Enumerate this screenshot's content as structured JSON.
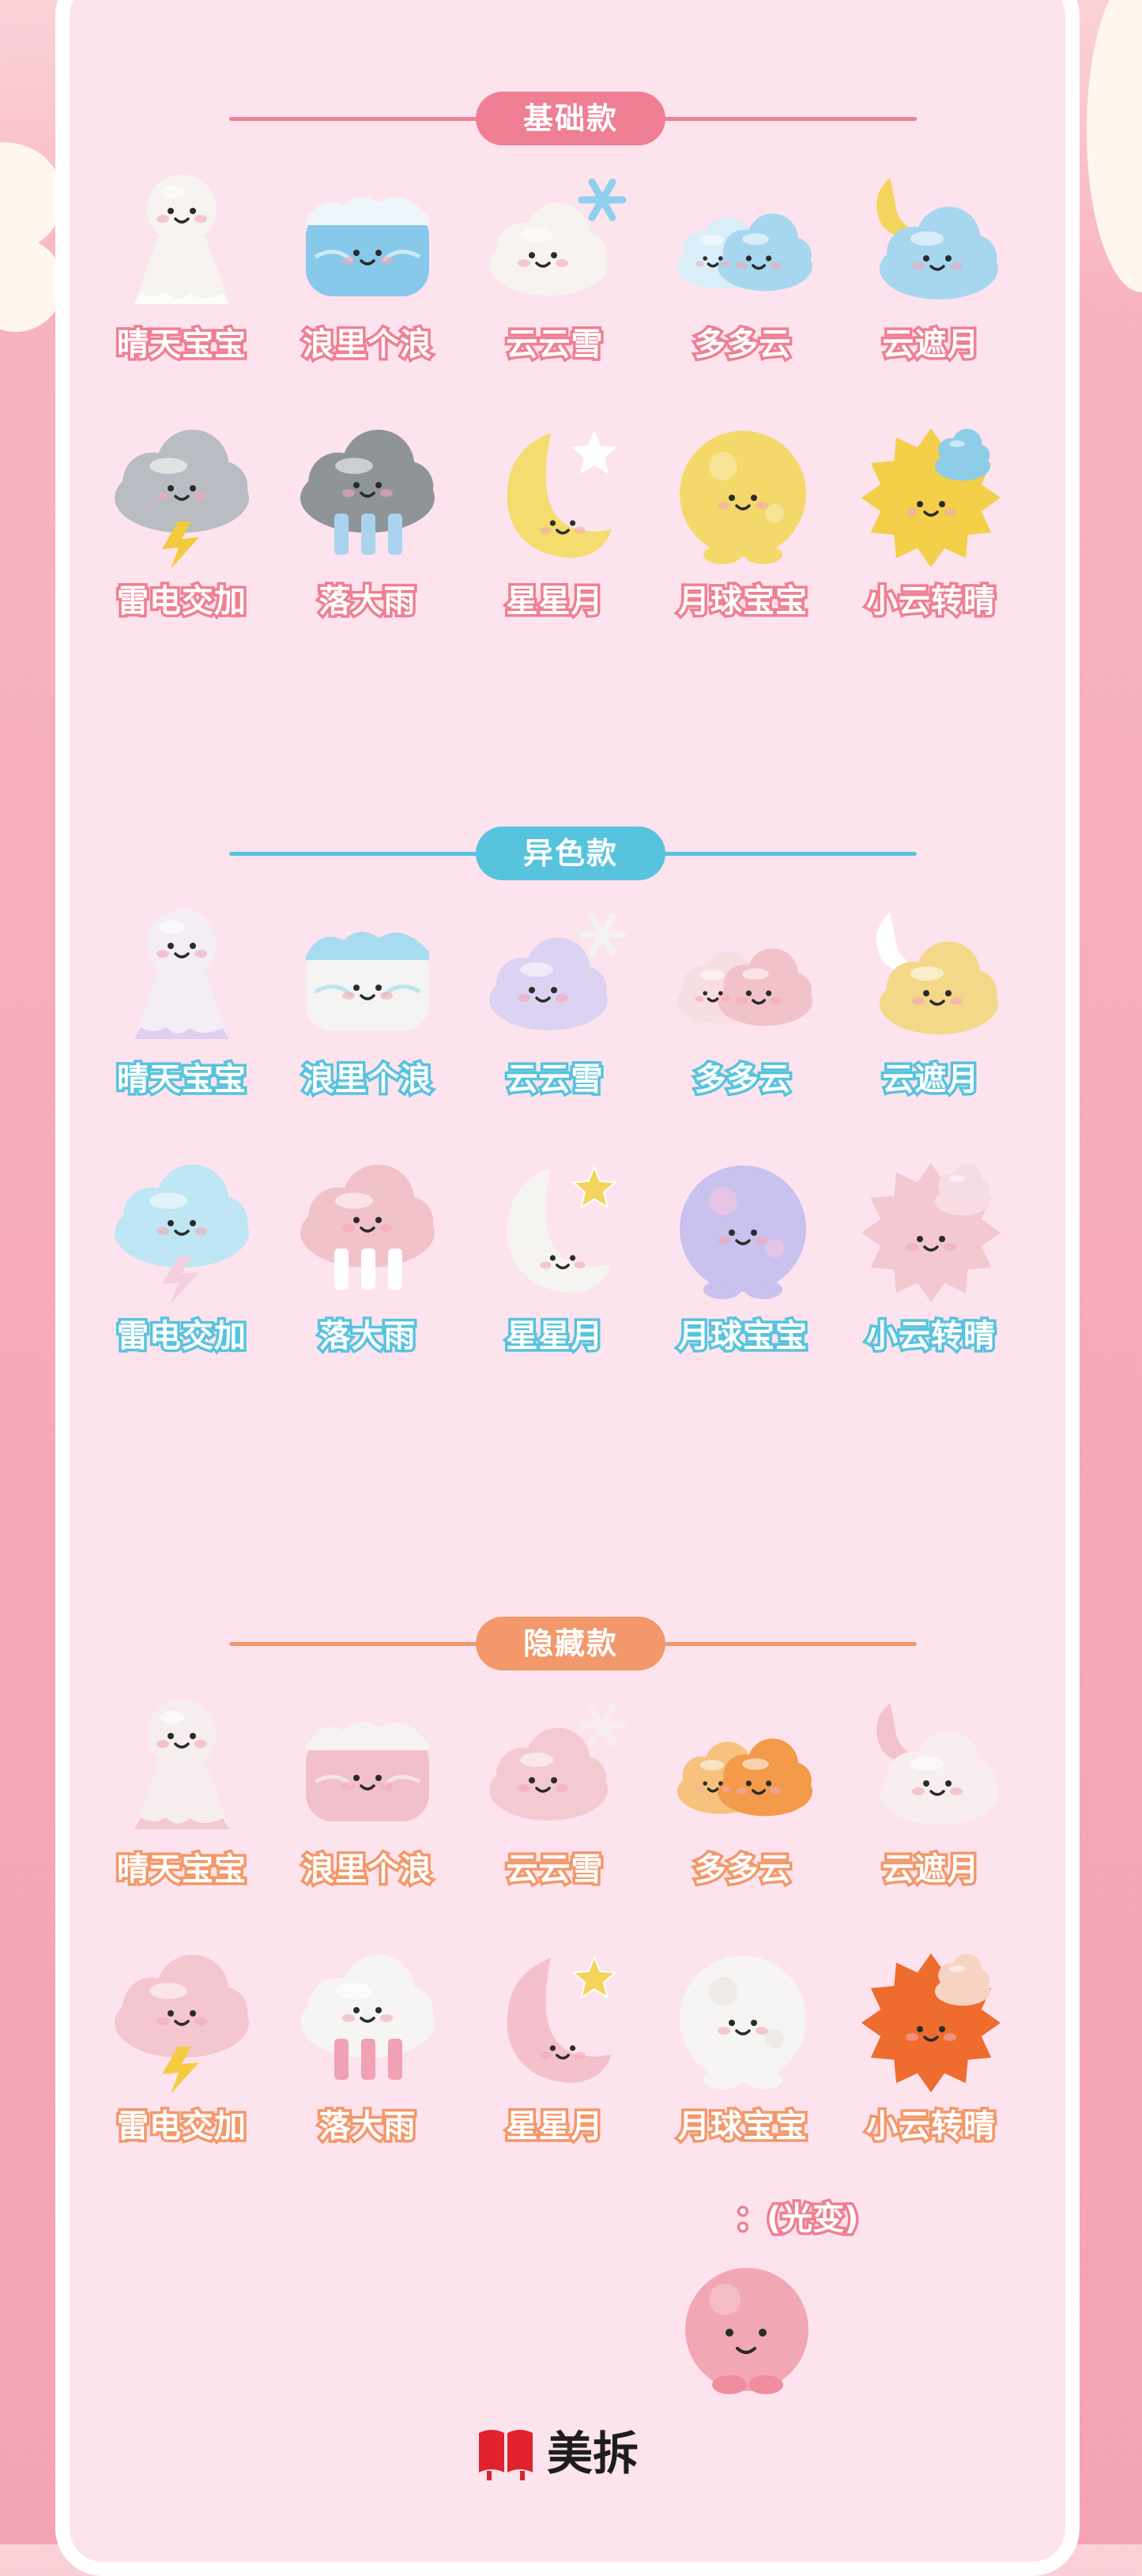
{
  "sections": [
    {
      "key": "basic",
      "title": "基础款",
      "line_color": "#ef7f92",
      "pill_color": "#ef7f92",
      "items": [
        {
          "label": "晴天宝宝",
          "icon": "sunny-doll-figure-icon",
          "shape": "doll",
          "body": "#f6f3f0",
          "accent": "#ffffff"
        },
        {
          "label": "浪里个浪",
          "icon": "wave-cloud-figure-icon",
          "shape": "wave",
          "body": "#86c9ea",
          "accent": "#eef6fb"
        },
        {
          "label": "云云雪",
          "icon": "snow-cloud-figure-icon",
          "shape": "snow",
          "body": "#f7f4f0",
          "accent": "#8fd0ec"
        },
        {
          "label": "多多云",
          "icon": "double-cloud-figure-icon",
          "shape": "double",
          "body": "#a7d7ef",
          "accent": "#d9eef8"
        },
        {
          "label": "云遮月",
          "icon": "moon-cloud-figure-icon",
          "shape": "mooncloud",
          "body": "#a7d7ef",
          "accent": "#f4d45c"
        },
        {
          "label": "雷电交加",
          "icon": "thunder-cloud-figure-icon",
          "shape": "thunder",
          "body": "#b9bcc2",
          "accent": "#f1cb3e"
        },
        {
          "label": "落大雨",
          "icon": "rain-cloud-figure-icon",
          "shape": "rain",
          "body": "#8f9499",
          "accent": "#a9d3ef"
        },
        {
          "label": "星星月",
          "icon": "star-moon-figure-icon",
          "shape": "starmoon",
          "body": "#f4dc6e",
          "accent": "#ffffff"
        },
        {
          "label": "月球宝宝",
          "icon": "moon-ball-figure-icon",
          "shape": "ball",
          "body": "#f4d96a",
          "accent": "#f7e8a6"
        },
        {
          "label": "小云转晴",
          "icon": "sun-cloud-figure-icon",
          "shape": "sun",
          "body": "#f3cf4a",
          "accent": "#8dcde8"
        }
      ]
    },
    {
      "key": "alt",
      "title": "异色款",
      "line_color": "#57c3dd",
      "pill_color": "#57c3dd",
      "items": [
        {
          "label": "晴天宝宝",
          "icon": "sunny-doll-figure-icon",
          "shape": "doll",
          "body": "#f3eef6",
          "accent": "#d7c2ef"
        },
        {
          "label": "浪里个浪",
          "icon": "wave-cloud-figure-icon",
          "shape": "wave",
          "body": "#f4f5f2",
          "accent": "#a7dbef"
        },
        {
          "label": "云云雪",
          "icon": "snow-cloud-figure-icon",
          "shape": "snow",
          "body": "#dcd2f1",
          "accent": "#f2f2f4"
        },
        {
          "label": "多多云",
          "icon": "double-cloud-figure-icon",
          "shape": "double",
          "body": "#f2c2cb",
          "accent": "#f8dde2"
        },
        {
          "label": "云遮月",
          "icon": "moon-cloud-figure-icon",
          "shape": "mooncloud",
          "body": "#f3d88a",
          "accent": "#ffffff"
        },
        {
          "label": "雷电交加",
          "icon": "thunder-cloud-figure-icon",
          "shape": "thunder",
          "body": "#bfe6f4",
          "accent": "#f4cfe0"
        },
        {
          "label": "落大雨",
          "icon": "rain-cloud-figure-icon",
          "shape": "rain",
          "body": "#f2c2ca",
          "accent": "#ffffff"
        },
        {
          "label": "星星月",
          "icon": "star-moon-figure-icon",
          "shape": "starmoon",
          "body": "#f6f4f0",
          "accent": "#f4d45c"
        },
        {
          "label": "月球宝宝",
          "icon": "moon-ball-figure-icon",
          "shape": "ball",
          "body": "#c9c1ee",
          "accent": "#f1c6e3"
        },
        {
          "label": "小云转晴",
          "icon": "sun-cloud-figure-icon",
          "shape": "sun",
          "body": "#f3c8d1",
          "accent": "#f7dde3"
        }
      ]
    },
    {
      "key": "hid",
      "title": "隐藏款",
      "line_color": "#f2986a",
      "pill_color": "#f2986a",
      "items": [
        {
          "label": "晴天宝宝",
          "icon": "sunny-doll-figure-icon",
          "shape": "doll",
          "body": "#f6eeee",
          "accent": "#f2b9c3"
        },
        {
          "label": "浪里个浪",
          "icon": "wave-cloud-figure-icon",
          "shape": "wave",
          "body": "#f2c0cb",
          "accent": "#f7f2f2"
        },
        {
          "label": "云云雪",
          "icon": "snow-cloud-figure-icon",
          "shape": "snow",
          "body": "#f4cad2",
          "accent": "#f7ecee"
        },
        {
          "label": "多多云",
          "icon": "double-cloud-figure-icon",
          "shape": "double",
          "body": "#f39a4b",
          "accent": "#f7c27d"
        },
        {
          "label": "云遮月",
          "icon": "moon-cloud-figure-icon",
          "shape": "mooncloud",
          "body": "#f8eef0",
          "accent": "#f3c3cd"
        },
        {
          "label": "雷电交加",
          "icon": "thunder-cloud-figure-icon",
          "shape": "thunder",
          "body": "#f4c6cf",
          "accent": "#f4cc3e"
        },
        {
          "label": "落大雨",
          "icon": "rain-cloud-figure-icon",
          "shape": "rain",
          "body": "#f7f5f4",
          "accent": "#f0a1b5"
        },
        {
          "label": "星星月",
          "icon": "star-moon-figure-icon",
          "shape": "starmoon",
          "body": "#f3c0cb",
          "accent": "#f4d45c"
        },
        {
          "label": "月球宝宝",
          "icon": "moon-ball-figure-icon",
          "shape": "ball",
          "body": "#f7f5f3",
          "accent": "#e9e6e2"
        },
        {
          "label": "小云转晴",
          "icon": "sun-cloud-figure-icon",
          "shape": "sun",
          "body": "#ef6c2f",
          "accent": "#f6d3c2"
        }
      ]
    }
  ],
  "extra": {
    "label": "：(光变)",
    "icon": "light-change-moon-ball-figure-icon",
    "body": "#f1a8b4",
    "accent": "#f7cad2"
  },
  "brand": {
    "name": "美拆",
    "logo_icon": "meichai-logo-icon",
    "logo_color": "#e0222c"
  }
}
